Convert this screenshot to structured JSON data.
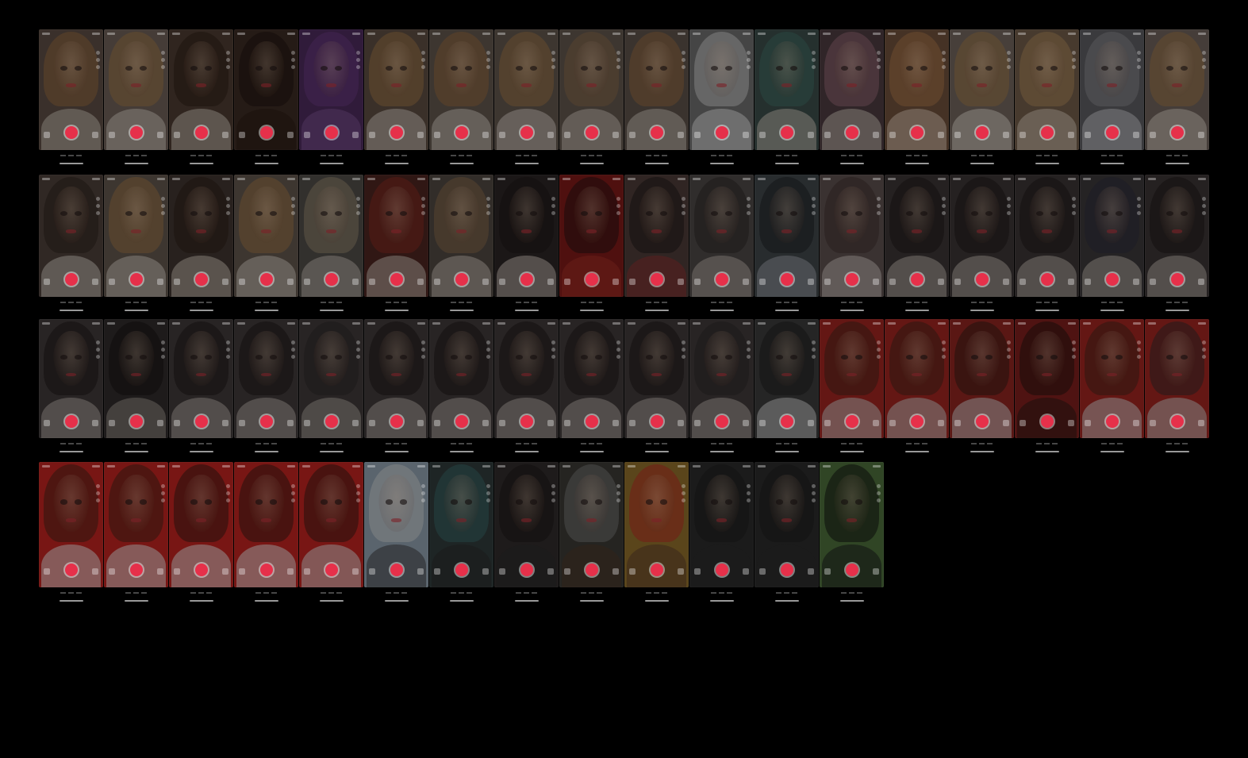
{
  "colors": {
    "background": "#000000",
    "record_button": "#e6304a",
    "red_backdrop": "#b8231f",
    "grey_backdrop": "#595959"
  },
  "rows": [
    {
      "row_id": "row-1",
      "tiles": [
        {
          "theme": "red-lips-filter",
          "bg": "#5a4a42",
          "hair": "#9a6b3c",
          "body": "#c9bfb5"
        },
        {
          "theme": "squint-filter",
          "bg": "#6a5d55",
          "hair": "#a27743",
          "body": "#cfc6bd"
        },
        {
          "theme": "cartoon-big-eyes",
          "bg": "#4a3a30",
          "hair": "#2a1a12",
          "body": "#c9bfb5"
        },
        {
          "theme": "cartoon-dark-skin",
          "bg": "#3a2a22",
          "hair": "#1a100c",
          "body": "#2a1a14"
        },
        {
          "theme": "purple-tint",
          "bg": "#4b2a5a",
          "hair": "#6a3a80",
          "body": "#7a5090"
        },
        {
          "theme": "flower-glasses",
          "bg": "#5a4a40",
          "hair": "#a27743",
          "body": "#cfc6bd"
        },
        {
          "theme": "warp-face",
          "bg": "#5e534b",
          "hair": "#9a6b3c",
          "body": "#cfc6bd"
        },
        {
          "theme": "clown-nose",
          "bg": "#5e534b",
          "hair": "#a27743",
          "body": "#d2c9c0"
        },
        {
          "theme": "mask-face",
          "bg": "#5e534b",
          "hair": "#8a6a48",
          "body": "#c9bfb5"
        },
        {
          "theme": "dark-lips",
          "bg": "#5a4f48",
          "hair": "#9a6b3c",
          "body": "#c9bfb5"
        },
        {
          "theme": "comic-sketch",
          "bg": "#6a6a6a",
          "hair": "#cfcfcf",
          "body": "#dcdcdc"
        },
        {
          "theme": "green-hair",
          "bg": "#3a4a48",
          "hair": "#3d6e64",
          "body": "#c9bfb5"
        },
        {
          "theme": "pink-hair",
          "bg": "#4a3a3e",
          "hair": "#9a6a78",
          "body": "#c9bfb5"
        },
        {
          "theme": "warm-tone",
          "bg": "#6a4d3a",
          "hair": "#b07a48",
          "body": "#d8c4b0"
        },
        {
          "theme": "soft-tone",
          "bg": "#6e625a",
          "hair": "#a27743",
          "body": "#d8d0c8"
        },
        {
          "theme": "lion-mane",
          "bg": "#6e5a48",
          "hair": "#b08a5a",
          "body": "#d2c2b0"
        },
        {
          "theme": "big-mouth",
          "bg": "#5a5a5e",
          "hair": "#8a8a90",
          "body": "#c4c4c8"
        },
        {
          "theme": "big-lips",
          "bg": "#6a5e58",
          "hair": "#a27743",
          "body": "#d2c9c0"
        }
      ]
    },
    {
      "row_id": "row-2",
      "tiles": [
        {
          "theme": "cartoon-girl",
          "bg": "#4a3e38",
          "hair": "#2a1e18",
          "body": "#cfc6bd"
        },
        {
          "theme": "wide-face",
          "bg": "#5e534b",
          "hair": "#a27743",
          "body": "#cfc6bd"
        },
        {
          "theme": "cartoon-wavy-hair",
          "bg": "#3e342e",
          "hair": "#2a1a14",
          "body": "#c9bfb5"
        },
        {
          "theme": "natural",
          "bg": "#5e534b",
          "hair": "#a27743",
          "body": "#cfc6bd"
        },
        {
          "theme": "sketch-pose",
          "bg": "#4e4a46",
          "hair": "#9a8a70",
          "body": "#bdb5ad"
        },
        {
          "theme": "red-hair",
          "bg": "#4a2420",
          "hair": "#8a2a20",
          "body": "#c9bfb5"
        },
        {
          "theme": "vampire",
          "bg": "#4e4640",
          "hair": "#8a6a48",
          "body": "#c4bbb2"
        },
        {
          "theme": "asian-portrait",
          "bg": "#2a2424",
          "hair": "#1a1414",
          "body": "#c9bfb5"
        },
        {
          "theme": "new-year-red",
          "bg": "#7a1a18",
          "hair": "#1a1010",
          "body": "#a03028"
        },
        {
          "theme": "festival-costume",
          "bg": "#4a3a36",
          "hair": "#1a1414",
          "body": "#8a3030"
        },
        {
          "theme": "flower-crown",
          "bg": "#4a4644",
          "hair": "#2a2424",
          "body": "#b4aca4"
        },
        {
          "theme": "ancient-style",
          "bg": "#3e4448",
          "hair": "#1a1c1e",
          "body": "#9aa0a6"
        },
        {
          "theme": "opera-style",
          "bg": "#5a4e4c",
          "hair": "#3a2a2a",
          "body": "#c8bcb8"
        },
        {
          "theme": "portrait-a",
          "bg": "#3a3434",
          "hair": "#1a1414",
          "body": "#bab2aa"
        },
        {
          "theme": "portrait-b",
          "bg": "#3a3434",
          "hair": "#1a1414",
          "body": "#bab2aa"
        },
        {
          "theme": "portrait-c",
          "bg": "#3a3434",
          "hair": "#1a1414",
          "body": "#bab2aa"
        },
        {
          "theme": "beanie-braids",
          "bg": "#3a3638",
          "hair": "#2a2a3a",
          "body": "#bab2aa"
        },
        {
          "theme": "portrait-d",
          "bg": "#3a3434",
          "hair": "#1a1414",
          "body": "#bab2aa"
        }
      ]
    },
    {
      "row_id": "row-3",
      "tiles": [
        {
          "theme": "portrait-jewel",
          "bg": "#3e3838",
          "hair": "#1a1414",
          "body": "#b4aca4"
        },
        {
          "theme": "split-grid",
          "bg": "#2e2a2a",
          "hair": "#141010",
          "body": "#9a928a"
        },
        {
          "theme": "portrait-e",
          "bg": "#3e3838",
          "hair": "#1a1414",
          "body": "#b4aca4"
        },
        {
          "theme": "round-glasses",
          "bg": "#3e3838",
          "hair": "#1a1414",
          "body": "#b4aca4"
        },
        {
          "theme": "soft-blur",
          "bg": "#3e3838",
          "hair": "#2a2424",
          "body": "#aaa29a"
        },
        {
          "theme": "blush",
          "bg": "#3e3838",
          "hair": "#1a1414",
          "body": "#b4aca4"
        },
        {
          "theme": "portrait-f",
          "bg": "#3e3838",
          "hair": "#1a1414",
          "body": "#b4aca4"
        },
        {
          "theme": "face-paint",
          "bg": "#3e3838",
          "hair": "#1a1414",
          "body": "#b4aca4"
        },
        {
          "theme": "portrait-g",
          "bg": "#3e3838",
          "hair": "#1a1414",
          "body": "#b4aca4"
        },
        {
          "theme": "red-nose",
          "bg": "#3e3838",
          "hair": "#1a1414",
          "body": "#b4aca4"
        },
        {
          "theme": "tiara",
          "bg": "#3e3838",
          "hair": "#2a2424",
          "body": "#b4aca4"
        },
        {
          "theme": "cartoon-boy",
          "bg": "#3a3a3a",
          "hair": "#1a1a1a",
          "body": "#d0d0d0"
        },
        {
          "theme": "googly-eyes",
          "bg": "#9a2420",
          "hair": "#3a2418",
          "body": "#c8c8c8"
        },
        {
          "theme": "big-blue-eyes",
          "bg": "#9a2420",
          "hair": "#3a2418",
          "body": "#c8c8c8"
        },
        {
          "theme": "cartoon-man",
          "bg": "#8a2420",
          "hair": "#2a1a14",
          "body": "#d0d0d0"
        },
        {
          "theme": "cartoon-dark-man",
          "bg": "#7a1e1c",
          "hair": "#1a100c",
          "body": "#2a1a14"
        },
        {
          "theme": "cartoon-blue-eyes",
          "bg": "#9a2420",
          "hair": "#3a2418",
          "body": "#d0d0d0"
        },
        {
          "theme": "red-backdrop-man",
          "bg": "#9a2420",
          "hair": "#2a2a2a",
          "body": "#c8c8c8"
        }
      ]
    },
    {
      "row_id": "row-4",
      "tiles": [
        {
          "theme": "full-beard",
          "bg": "#b8231f",
          "hair": "#3a2418",
          "body": "#e0e0e0"
        },
        {
          "theme": "glasses-mustache",
          "bg": "#b8231f",
          "hair": "#3a2418",
          "body": "#e0e0e0"
        },
        {
          "theme": "goatee",
          "bg": "#b8231f",
          "hair": "#2a1a14",
          "body": "#e0e0e0"
        },
        {
          "theme": "thin-mustache",
          "bg": "#b8231f",
          "hair": "#2a1a14",
          "body": "#e0e0e0"
        },
        {
          "theme": "long-beard",
          "bg": "#b8231f",
          "hair": "#2a1a14",
          "body": "#d8d8d8"
        },
        {
          "theme": "old-man-glasses",
          "bg": "#8a9aa8",
          "hair": "#d0d0d0",
          "body": "#3a3a3a"
        },
        {
          "theme": "anime-boy",
          "bg": "#2e3a3a",
          "hair": "#3a6a6a",
          "body": "#2a2a2a"
        },
        {
          "theme": "tribal-paint",
          "bg": "#2e2a2a",
          "hair": "#1a1414",
          "body": "#2a2a2a"
        },
        {
          "theme": "viking-helmet",
          "bg": "#3a3834",
          "hair": "#7a7a7a",
          "body": "#4a3424"
        },
        {
          "theme": "pirate-frame",
          "bg": "#8a6a2a",
          "hair": "#b8231f",
          "body": "#5a3a2a"
        },
        {
          "theme": "cat-ears",
          "bg": "#2a2a2a",
          "hair": "#1a1a1a",
          "body": "#2a2a2a"
        },
        {
          "theme": "plain-man",
          "bg": "#2a2a2a",
          "hair": "#1a1a1a",
          "body": "#2a2a2a"
        },
        {
          "theme": "gentleman-hat",
          "bg": "#4a6a3a",
          "hair": "#0a0a0a",
          "body": "#1a1a1a"
        }
      ]
    }
  ]
}
